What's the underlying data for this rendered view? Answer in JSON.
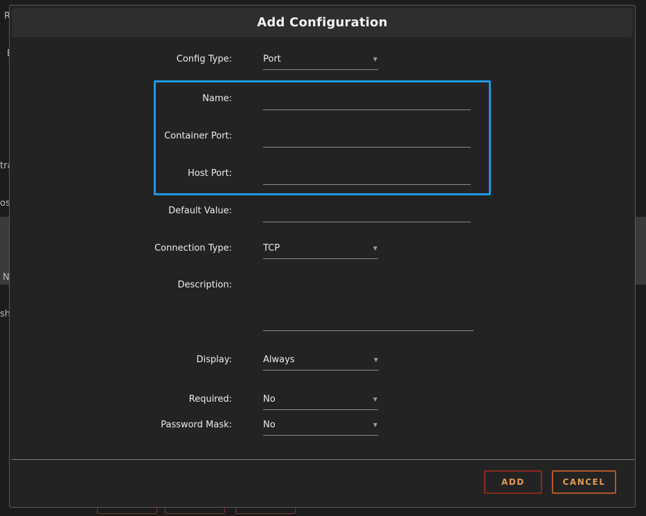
{
  "backdrop": {
    "fragments": [
      "R",
      "E",
      "tra",
      "os",
      "N",
      "she"
    ]
  },
  "dialog": {
    "title": "Add Configuration",
    "config_type": {
      "label": "Config Type:",
      "value": "Port"
    },
    "name": {
      "label": "Name:",
      "value": ""
    },
    "container_port": {
      "label": "Container Port:",
      "value": ""
    },
    "host_port": {
      "label": "Host Port:",
      "value": ""
    },
    "default_value": {
      "label": "Default Value:",
      "value": ""
    },
    "connection_type": {
      "label": "Connection Type:",
      "value": "TCP"
    },
    "description": {
      "label": "Description:",
      "value": ""
    },
    "display": {
      "label": "Display:",
      "value": "Always"
    },
    "required": {
      "label": "Required:",
      "value": "No"
    },
    "password_mask": {
      "label": "Password Mask:",
      "value": "No"
    },
    "buttons": {
      "add": "ADD",
      "cancel": "CANCEL"
    }
  },
  "colors": {
    "highlight": "#1e9be6",
    "button_text": "#e29a52",
    "add_border": "#8a2a1f",
    "cancel_border": "#b35a2a"
  },
  "icons": {
    "dropdown": "chevron-down-icon"
  }
}
